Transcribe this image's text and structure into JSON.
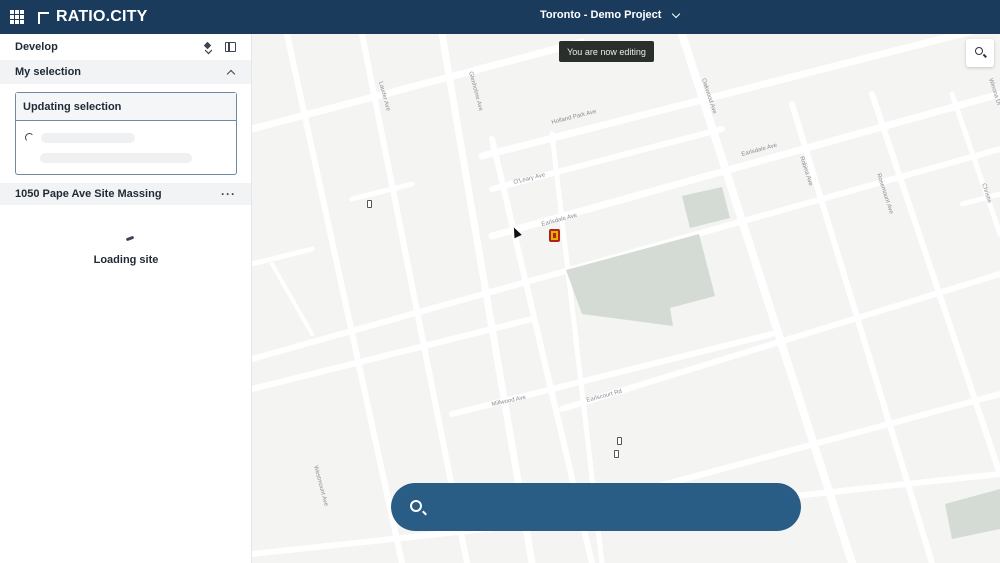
{
  "header": {
    "logo_text": "RATIO.CITY",
    "project_name": "Toronto - Demo Project"
  },
  "sidebar": {
    "section_title": "Develop",
    "selection_title": "My selection",
    "selection_box_title": "Updating selection",
    "site_name": "1050 Pape Ave Site Massing",
    "loading_text": "Loading site"
  },
  "map": {
    "tooltip": "You are now editing",
    "street_labels": {
      "holland_park": "Holland Park Ave",
      "earlsdale_top": "Earlsdale Ave",
      "oleary": "O'Leary Ave",
      "earlsdale": "Earlsdale Ave",
      "millwood": "Millwood Ave",
      "earlscourt": "Earlscourt Rd",
      "lauder": "Lauder Ave",
      "glenholme": "Glenholme Ave",
      "oakwood": "Oakwood Ave",
      "rosemount": "Rosemount Ave",
      "robina": "Robina Ave",
      "westmount": "Westmount Ave",
      "winona": "Winona Dr",
      "christie": "Christie"
    }
  }
}
